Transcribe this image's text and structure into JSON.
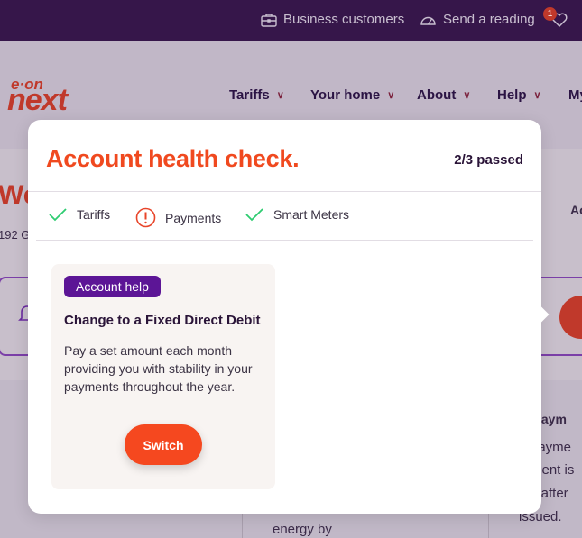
{
  "topbar": {
    "business": "Business customers",
    "reading": "Send a reading",
    "notification_count": "1"
  },
  "brand": {
    "logo_top": "e·on",
    "logo_bottom": "next"
  },
  "nav": [
    {
      "label": "Tariffs"
    },
    {
      "label": "Your home"
    },
    {
      "label": "About"
    },
    {
      "label": "Help"
    },
    {
      "label": "My"
    }
  ],
  "background": {
    "welcome": "We",
    "address": "192 G",
    "account": "Ac",
    "next_payment": "xt paym",
    "line1": "payme",
    "line2": "ment is",
    "line3": "s after",
    "line4": "issued.",
    "energy": "energy by"
  },
  "modal": {
    "title": "Account health check.",
    "passed": "2/3 passed",
    "checks": [
      {
        "label": "Tariffs",
        "status": "pass"
      },
      {
        "label": "Payments",
        "status": "warning"
      },
      {
        "label": "Smart Meters",
        "status": "pass"
      }
    ],
    "card": {
      "badge": "Account help",
      "heading": "Change to a Fixed Direct Debit",
      "body": "Pay a set amount each month providing you with stability in your payments throughout the year.",
      "button": "Switch"
    }
  },
  "colors": {
    "accent": "#f0491f",
    "brand_purple": "#36164a",
    "badge": "#5c1596",
    "pass": "#2ecc71"
  }
}
